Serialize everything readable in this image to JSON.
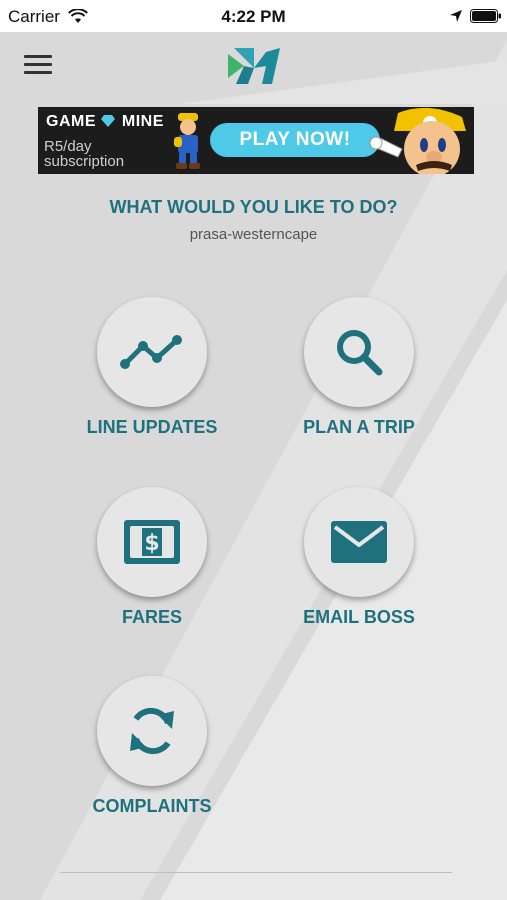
{
  "status_bar": {
    "carrier": "Carrier",
    "time": "4:22 PM"
  },
  "ad": {
    "brand_game": "GAME",
    "brand_mine": "MINE",
    "subtitle": "R5/day subscription",
    "cta": "PLAY NOW!"
  },
  "main": {
    "heading": "WHAT WOULD YOU LIKE TO DO?",
    "subheading": "prasa-westerncape"
  },
  "actions": [
    {
      "label": "LINE UPDATES",
      "icon": "trend-line-icon"
    },
    {
      "label": "PLAN A TRIP",
      "icon": "search-icon"
    },
    {
      "label": "FARES",
      "icon": "dollar-ticket-icon"
    },
    {
      "label": "EMAIL BOSS",
      "icon": "envelope-icon"
    },
    {
      "label": "COMPLAINTS",
      "icon": "refresh-icon"
    }
  ],
  "colors": {
    "accent": "#20717e",
    "logo_green": "#3db36b",
    "logo_teal": "#1d8a9a",
    "ad_button": "#4fc9e8"
  }
}
